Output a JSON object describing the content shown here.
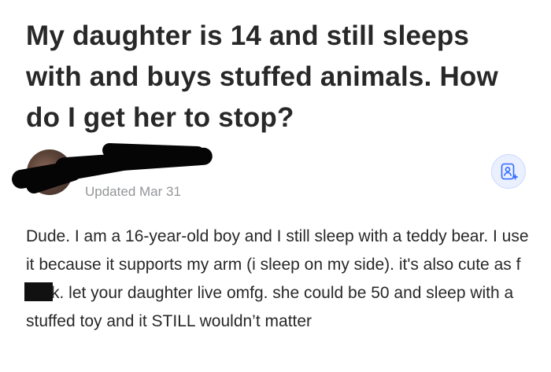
{
  "question": {
    "title": "My daughter is 14 and still sleeps with and buys stuffed animals. How do I get her to stop?"
  },
  "author": {
    "updated": "Updated Mar 31",
    "follow_icon": "add-follow-icon",
    "accent_color": "#2e69ff"
  },
  "answer": {
    "text_part1": "Dude. I am a 16-year-old boy and I still sleep with a teddy bear. I use it because it supports my arm (i sleep on my side). it's also cute as f",
    "text_part2": "k. let your daughter live omfg. she could be 50 and sleep with a stuffed toy and it STILL wouldn’t matter"
  }
}
